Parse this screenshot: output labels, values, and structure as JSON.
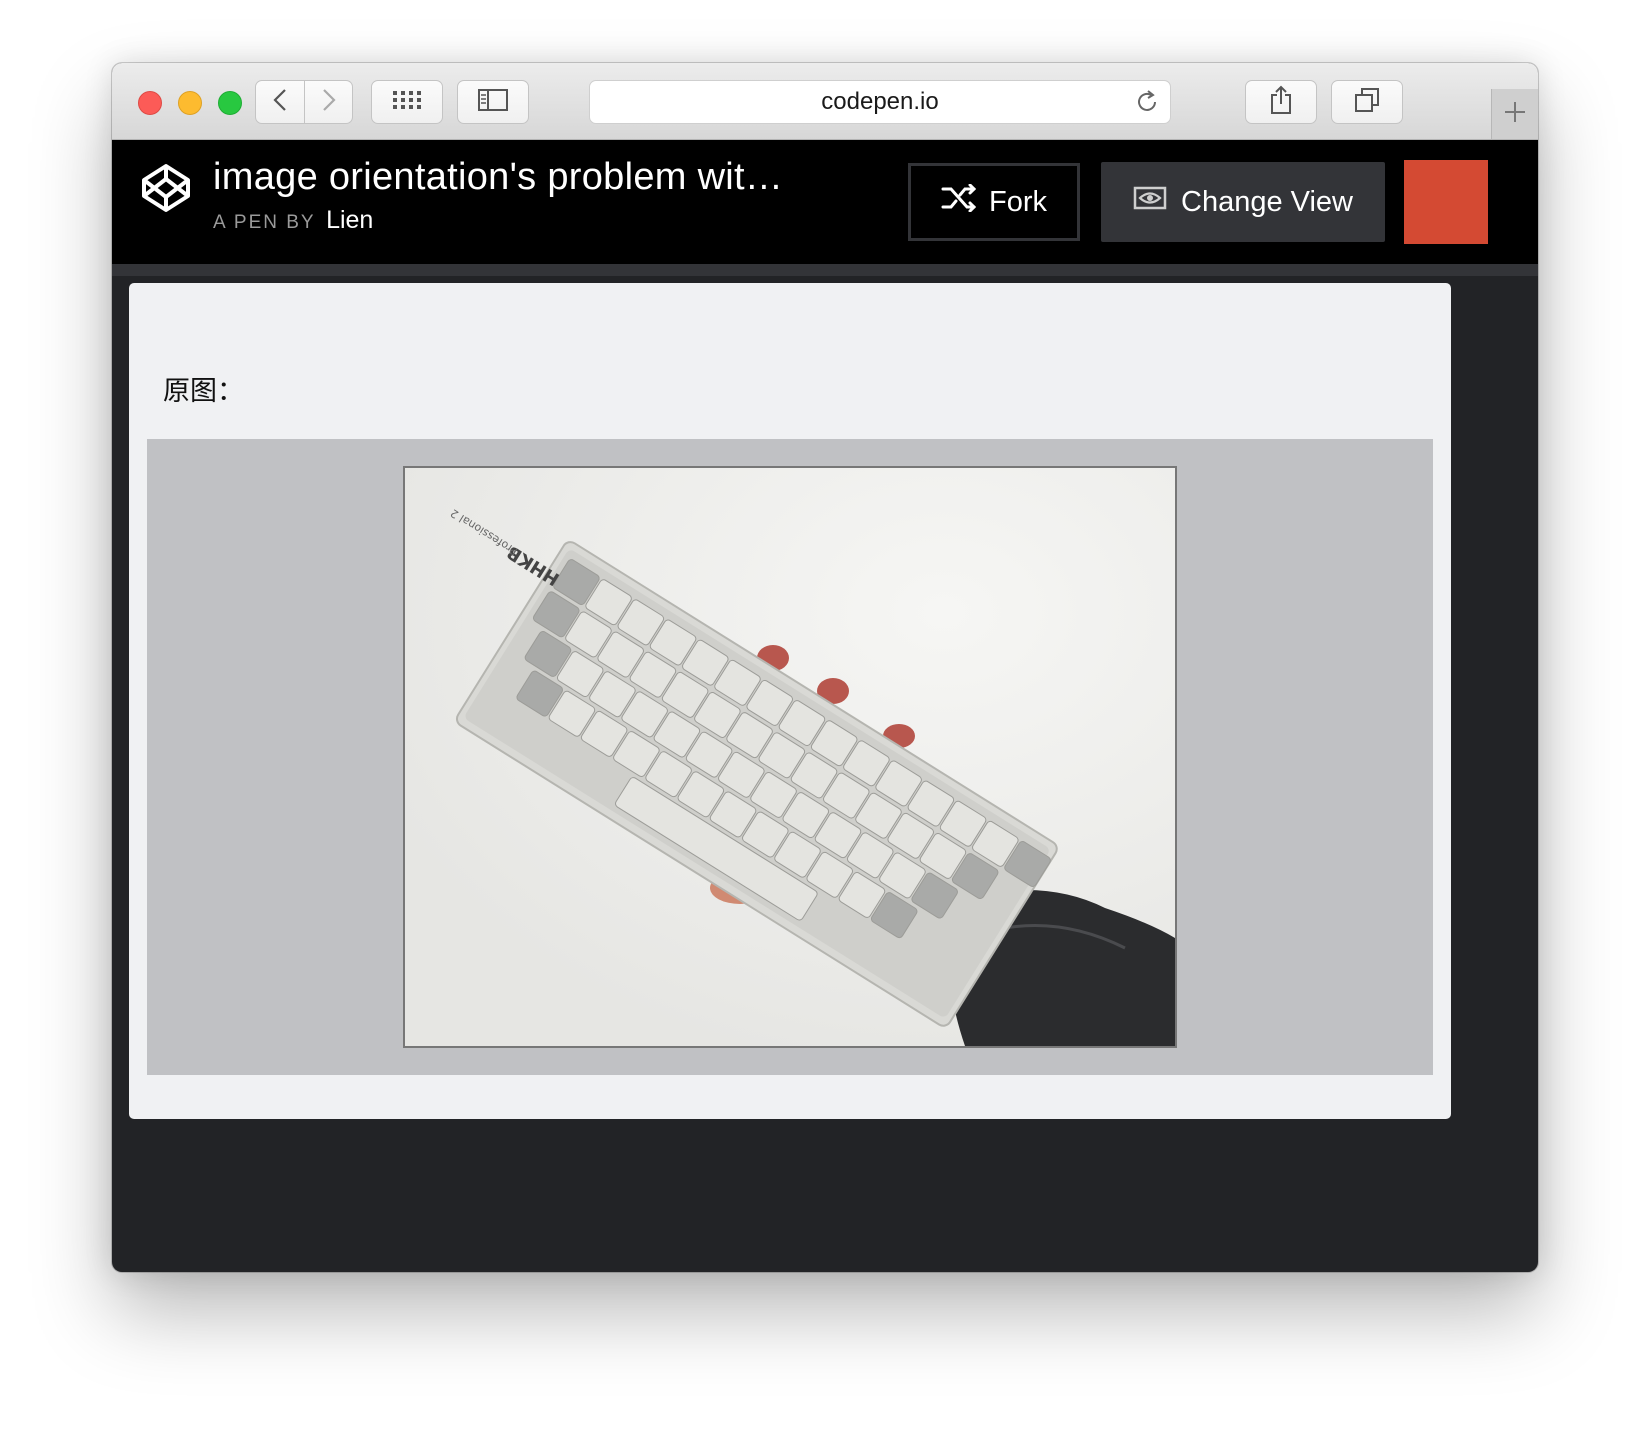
{
  "browser": {
    "url": "codepen.io"
  },
  "pen": {
    "title": "image orientation's problem wit…",
    "byline_prefix": "A PEN BY",
    "author": "Lien",
    "fork_label": "Fork",
    "change_view_label": "Change View",
    "accent_color": "#d44a33"
  },
  "result": {
    "label": "原图：",
    "image_alt": "HHKB keyboard held in hand",
    "keyboard_brand": "HHKB",
    "keyboard_model": "Professional 2"
  }
}
